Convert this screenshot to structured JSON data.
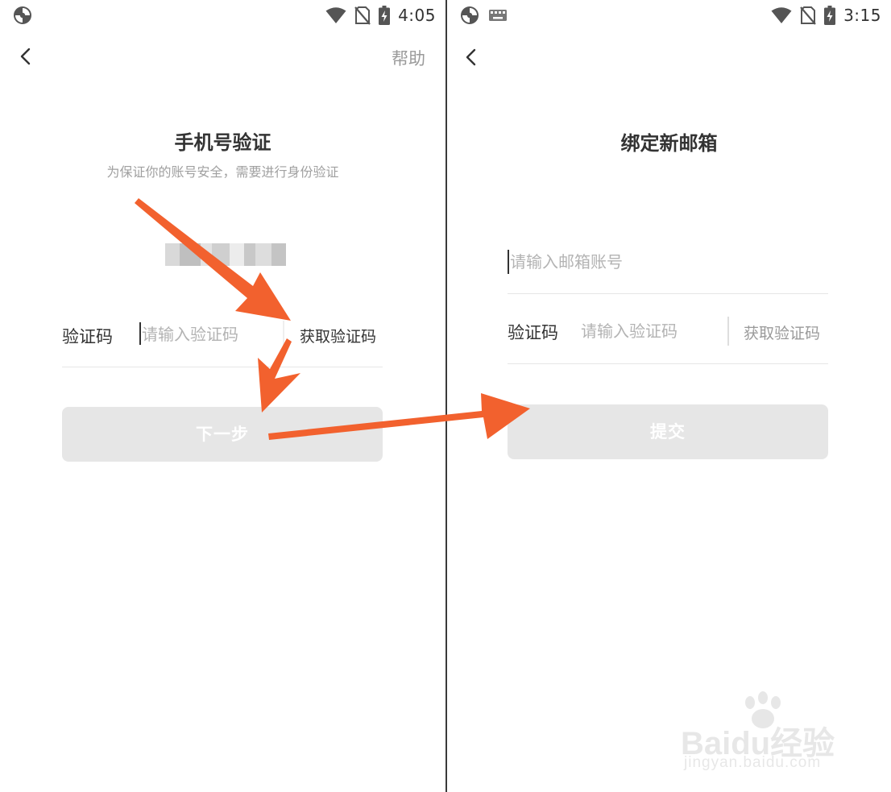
{
  "left_screen": {
    "status": {
      "time": "4:05"
    },
    "help_label": "帮助",
    "title": "手机号验证",
    "subtitle": "为保证你的账号安全，需要进行身份验证",
    "code_label": "验证码",
    "code_placeholder": "请输入验证码",
    "get_code_label": "获取验证码",
    "next_label": "下一步"
  },
  "right_screen": {
    "status": {
      "time": "3:15"
    },
    "title": "绑定新邮箱",
    "email_placeholder": "请输入邮箱账号",
    "code_label": "验证码",
    "code_placeholder": "请输入验证码",
    "get_code_label": "获取验证码",
    "submit_label": "提交"
  },
  "watermark": {
    "brand": "Baidu经验",
    "url": "jingyan.baidu.com"
  },
  "colors": {
    "accent_arrow": "#f2612e",
    "button_disabled": "#e6e6e6",
    "get_code_active": "#333333",
    "get_code_inactive": "#9a9a9a",
    "placeholder": "#b3b3b3"
  },
  "icons": {
    "app": "app-logo-icon",
    "keyboard": "keyboard-icon",
    "wifi": "wifi-icon",
    "no_sim": "no-sim-icon",
    "battery": "battery-charging-icon",
    "back": "back-arrow-icon"
  }
}
